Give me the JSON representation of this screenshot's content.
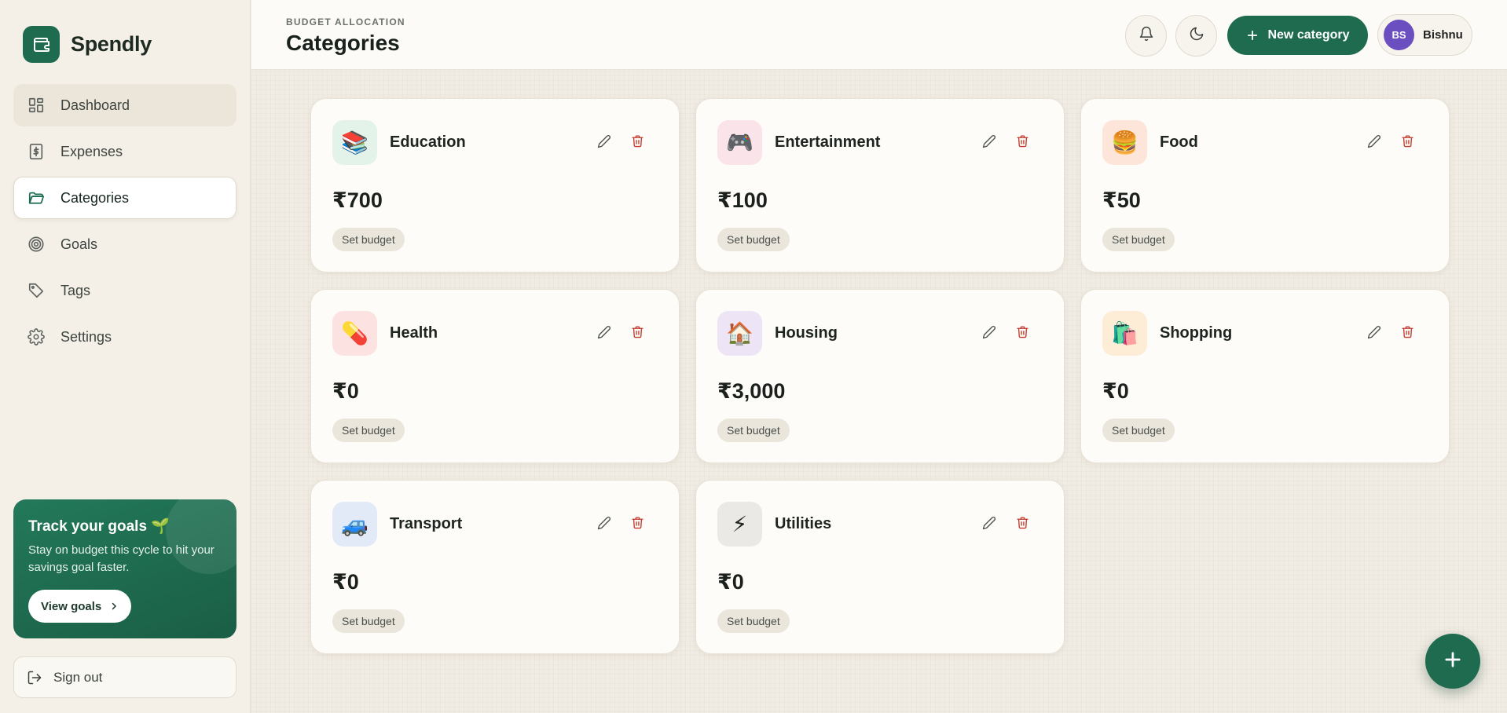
{
  "app": {
    "name": "Spendly"
  },
  "sidebar": {
    "items": [
      {
        "label": "Dashboard",
        "icon": "dashboard-icon"
      },
      {
        "label": "Expenses",
        "icon": "dollar-icon"
      },
      {
        "label": "Categories",
        "icon": "folder-icon"
      },
      {
        "label": "Goals",
        "icon": "target-icon"
      },
      {
        "label": "Tags",
        "icon": "tag-icon"
      },
      {
        "label": "Settings",
        "icon": "gear-icon"
      }
    ],
    "active": "Categories",
    "promo": {
      "title": "Track your goals 🌱",
      "text": "Stay on budget this cycle to hit your savings goal faster.",
      "button": "View goals"
    },
    "signout": "Sign out"
  },
  "header": {
    "eyebrow": "BUDGET ALLOCATION",
    "title": "Categories",
    "new_button": "New category",
    "user": {
      "initials": "BS",
      "name": "Bishnu"
    }
  },
  "categories": [
    {
      "name": "Education",
      "amount": "₹700",
      "budget_label": "Set budget",
      "emoji": "📚",
      "icon_bg": "#e3f3ea"
    },
    {
      "name": "Entertainment",
      "amount": "₹100",
      "budget_label": "Set budget",
      "emoji": "🎮",
      "icon_bg": "#fbe3ea"
    },
    {
      "name": "Food",
      "amount": "₹50",
      "budget_label": "Set budget",
      "emoji": "🍔",
      "icon_bg": "#fde6d9"
    },
    {
      "name": "Health",
      "amount": "₹0",
      "budget_label": "Set budget",
      "emoji": "💊",
      "icon_bg": "#fde2e2"
    },
    {
      "name": "Housing",
      "amount": "₹3,000",
      "budget_label": "Set budget",
      "emoji": "🏠",
      "icon_bg": "#ede5f6"
    },
    {
      "name": "Shopping",
      "amount": "₹0",
      "budget_label": "Set budget",
      "emoji": "🛍️",
      "icon_bg": "#fdecd6"
    },
    {
      "name": "Transport",
      "amount": "₹0",
      "budget_label": "Set budget",
      "emoji": "🚙",
      "icon_bg": "#e2eaf8"
    },
    {
      "name": "Utilities",
      "amount": "₹0",
      "budget_label": "Set budget",
      "emoji": "⚡",
      "icon_bg": "#ebe9e6"
    }
  ],
  "colors": {
    "brand": "#1e6b4f",
    "delete": "#c0392b",
    "avatar": "#6b4fc1"
  }
}
